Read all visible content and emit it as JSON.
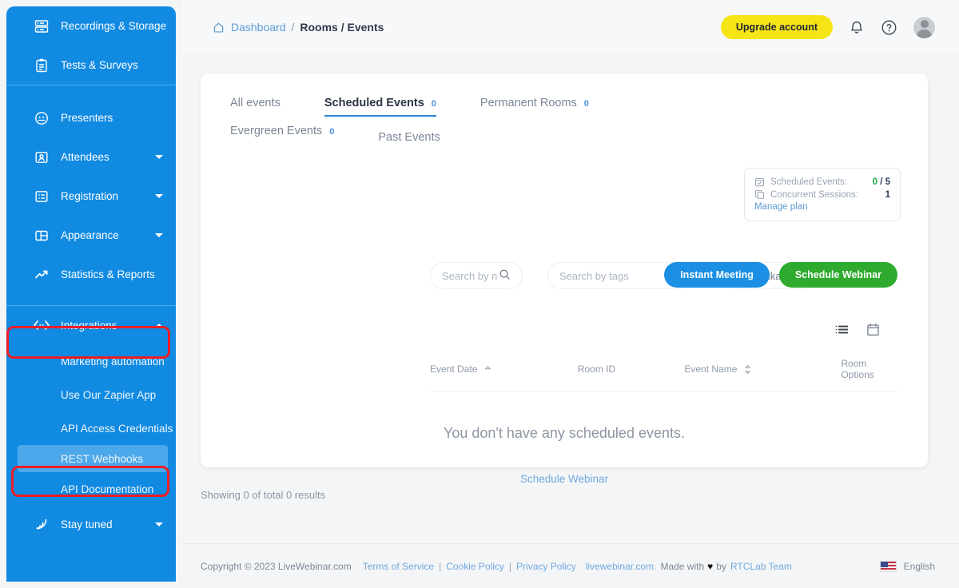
{
  "sidebar": {
    "group_top": [
      {
        "label": "Recordings & Storage",
        "icon": "server-icon",
        "caret": false
      },
      {
        "label": "Tests & Surveys",
        "icon": "clipboard-icon",
        "caret": false
      }
    ],
    "group_mid": [
      {
        "label": "Presenters",
        "icon": "presenter-icon",
        "caret": false
      },
      {
        "label": "Attendees",
        "icon": "attendees-icon",
        "caret": true
      },
      {
        "label": "Registration",
        "icon": "registration-icon",
        "caret": true
      },
      {
        "label": "Appearance",
        "icon": "appearance-icon",
        "caret": true
      },
      {
        "label": "Statistics & Reports",
        "icon": "chart-trend-icon",
        "caret": false
      }
    ],
    "integrations": {
      "label": "Integrations",
      "icon": "code-brackets-icon",
      "expanded": true
    },
    "integration_children": [
      {
        "label": "Marketing automation",
        "active": false
      },
      {
        "label": "Use Our Zapier App",
        "active": false
      },
      {
        "label": "API Access Credentials",
        "active": false
      },
      {
        "label": "REST Webhooks",
        "active": true
      },
      {
        "label": "API Documentation",
        "active": false
      }
    ],
    "stay_tuned": {
      "label": "Stay tuned",
      "icon": "rss-icon",
      "caret": true
    },
    "colors": {
      "background": "#118ae2",
      "active_item": "#4ba8ea",
      "highlight": "#ee1c25"
    }
  },
  "topbar": {
    "breadcrumb": {
      "home_icon": "home-icon",
      "root": "Dashboard",
      "separator": "/",
      "current": "Rooms / Events"
    },
    "upgrade_label": "Upgrade account",
    "upgrade_color": "#f5e516",
    "icons": {
      "notifications": "bell-icon",
      "help": "question-circle-icon",
      "avatar": "avatar"
    }
  },
  "tabs": [
    {
      "label": "All events",
      "count": "",
      "active": false
    },
    {
      "label": "Scheduled Events",
      "count": "0",
      "active": true
    },
    {
      "label": "Permanent Rooms",
      "count": "0",
      "active": false
    },
    {
      "label": "Evergreen Events",
      "count": "0",
      "active": false
    },
    {
      "label": "Past Events",
      "count": "",
      "active": false
    }
  ],
  "plan_box": {
    "rows": [
      {
        "icon": "calendar-check-icon",
        "label": "Scheduled Events:",
        "value_accent": "0",
        "value_rest": " / 5"
      },
      {
        "icon": "copy-icon",
        "label": "Concurrent Sessions:",
        "value_accent": "",
        "value_rest": "1"
      }
    ],
    "manage_link": "Manage plan",
    "accent_color": "#18a642"
  },
  "filters": {
    "search_name_placeholder": "Search by n",
    "search_name_value": "",
    "search_name_icon": "search-icon",
    "search_tags_placeholder": "Search by tags",
    "search_tags_value": "",
    "search_tags_icon": "chevron-down-icon",
    "timezone_value": "Asia/Kolkata",
    "timezone_icon": "globe-icon"
  },
  "actions": {
    "instant_meeting": "Instant Meeting",
    "instant_meeting_color": "#1a8fe3",
    "schedule_webinar": "Schedule Webinar",
    "schedule_webinar_color": "#2eab2e"
  },
  "view_toggles": [
    {
      "icon": "list-view-icon",
      "active": true
    },
    {
      "icon": "calendar-view-icon",
      "active": false
    }
  ],
  "table": {
    "columns": [
      {
        "label": "Event Date",
        "sort": "asc"
      },
      {
        "label": "Room ID",
        "sort": "none"
      },
      {
        "label": "Event Name",
        "sort": "both"
      },
      {
        "label": "Room Options",
        "sort": "none"
      }
    ],
    "rows": [],
    "empty_message": "You don't have any scheduled events.",
    "empty_cta": "Schedule Webinar"
  },
  "results_text": "Showing 0 of total 0 results",
  "footer": {
    "copyright": "Copyright © 2023 LiveWebinar.com",
    "links": [
      {
        "label": "Terms of Service"
      },
      {
        "label": "Cookie Policy"
      },
      {
        "label": "Privacy Policy"
      }
    ],
    "separator": "|",
    "site": "livewebinar.com.",
    "made_with_pre": "Made with",
    "heart": "♥",
    "made_with_by": "by",
    "team": "RTCLab Team",
    "language": "English",
    "flag": "us-flag-icon"
  }
}
